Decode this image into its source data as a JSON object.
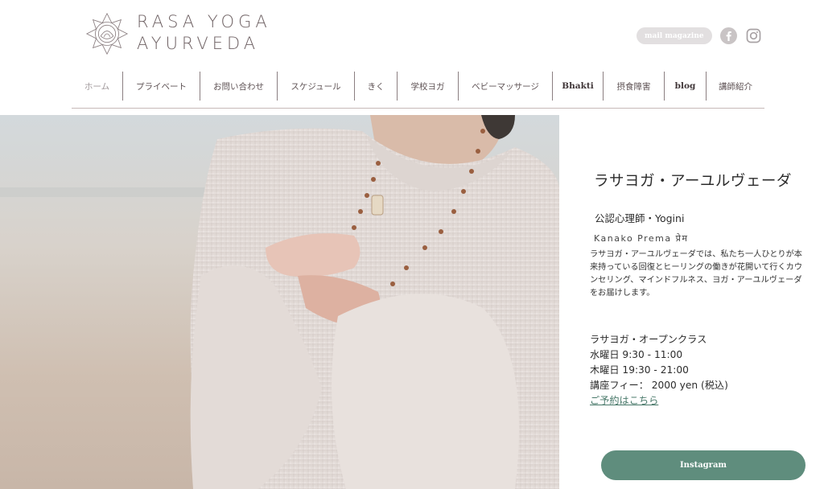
{
  "brand": {
    "line1": "RASA YOGA",
    "line2": "AYURVEDA",
    "logo_icon": "lotus-mandala-icon",
    "color": "#6f6264"
  },
  "social": {
    "mail_label": "mail magazine",
    "facebook_icon": "facebook-icon",
    "instagram_icon": "instagram-icon"
  },
  "nav": {
    "items": [
      {
        "label": "ホーム"
      },
      {
        "label": "プライベート"
      },
      {
        "label": "お問い合わせ"
      },
      {
        "label": "スケジュール"
      },
      {
        "label": "きく"
      },
      {
        "label": "学校ヨガ"
      },
      {
        "label": "ベビーマッサージ"
      },
      {
        "label": "Bhakti"
      },
      {
        "label": "摂食障害"
      },
      {
        "label": "blog"
      },
      {
        "label": "講師紹介"
      }
    ]
  },
  "hero": {
    "image": "woman-in-knit-sweater-with-mala-beads-photo"
  },
  "intro": {
    "title": "ラサヨガ・アーユルヴェーダ",
    "role": "公認心理師・Yogini",
    "name": "Kanako Prema प्रेम",
    "description": "ラサヨガ・アーユルヴェーダでは、私たち一人ひとりが本来持っている回復とヒーリングの働きが花開いて行くカウンセリング、マインドフルネス、ヨガ・アーユルヴェーダをお届けします。"
  },
  "open_class": {
    "heading": "ラサヨガ・オープンクラス",
    "schedule_1": "水曜日 9:30 - 11:00",
    "schedule_2": "木曜日 19:30 - 21:00",
    "fee": "講座フィー： 2000 yen (税込)",
    "booking_link": "ご予約はこちら"
  },
  "instagram_button": {
    "label": "Instagram",
    "color": "#5f8d7d"
  }
}
